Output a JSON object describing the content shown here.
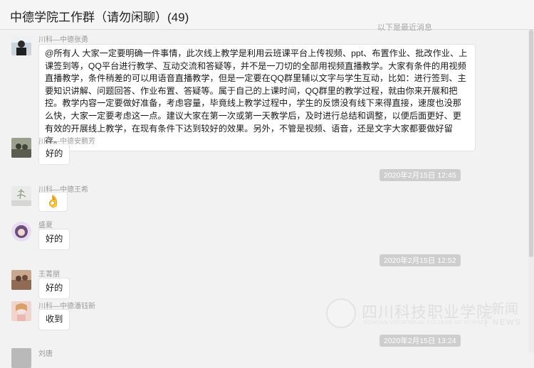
{
  "window": {
    "title": "中德学院工作群（请勿闲聊）(49)"
  },
  "top_note": "以下是最近消息",
  "messages": [
    {
      "sender": "川科—中德张勇",
      "text": "@所有人  大家一定要明确一件事情，此次线上教学是利用云班课平台上传视频、ppt、布置作业、批改作业、上课签到等，QQ平台进行教学、互动交流和答疑等，并不是一刀切的全部用视频直播教学。大家有条件的用视频直播教学，条件稍差的可以用语音直播教学，但是一定要在QQ群里辅以文字与学生互动，比如：进行签到、主要知识讲解、问题回答、作业布置、答疑等。属于自己的上课时间，QQ群里的教学过程，就由你来开展和把控。教学内容一定要做好准备，考虑容量，毕竟线上教学过程中，学生的反馈没有线下来得直接，速度也没那么快，大家一定要考虑这一点。建议大家在第一次或第一天教学后，及时进行总结和调整，以便后面更好、更有效的开展线上教学，在现有条件下达到较好的效果。另外，不管是视频、语音，还是文字大家都要做好留存。"
    },
    {
      "sender": "川科—中德安鹏芳",
      "text": "好的"
    },
    {
      "time": "2020年2月15日 12:45"
    },
    {
      "sender": "川科—中德王希",
      "emoji": "👌"
    },
    {
      "sender": "盛夏",
      "text": "好的"
    },
    {
      "time": "2020年2月15日 12:52"
    },
    {
      "sender": "王菁朋",
      "text": "好的"
    },
    {
      "sender": "川科—中德潘钰新",
      "text": "收到"
    },
    {
      "time": "2020年2月15日 13:24"
    },
    {
      "sender": "刘唐"
    }
  ],
  "watermark": {
    "name": "四川科技职业学院",
    "sub": "SICHUAN VOCATIONAL COLLEGE OF SCIENCE",
    "news": "新闻",
    "news_en": "NEWS"
  },
  "colors": {
    "background": "#f2f2f2",
    "bubble": "#ffffff",
    "time_badge": "#cecece",
    "sender": "#9a9a9a"
  },
  "icons": [
    "avatar-photo",
    "ok-hand-emoji"
  ]
}
